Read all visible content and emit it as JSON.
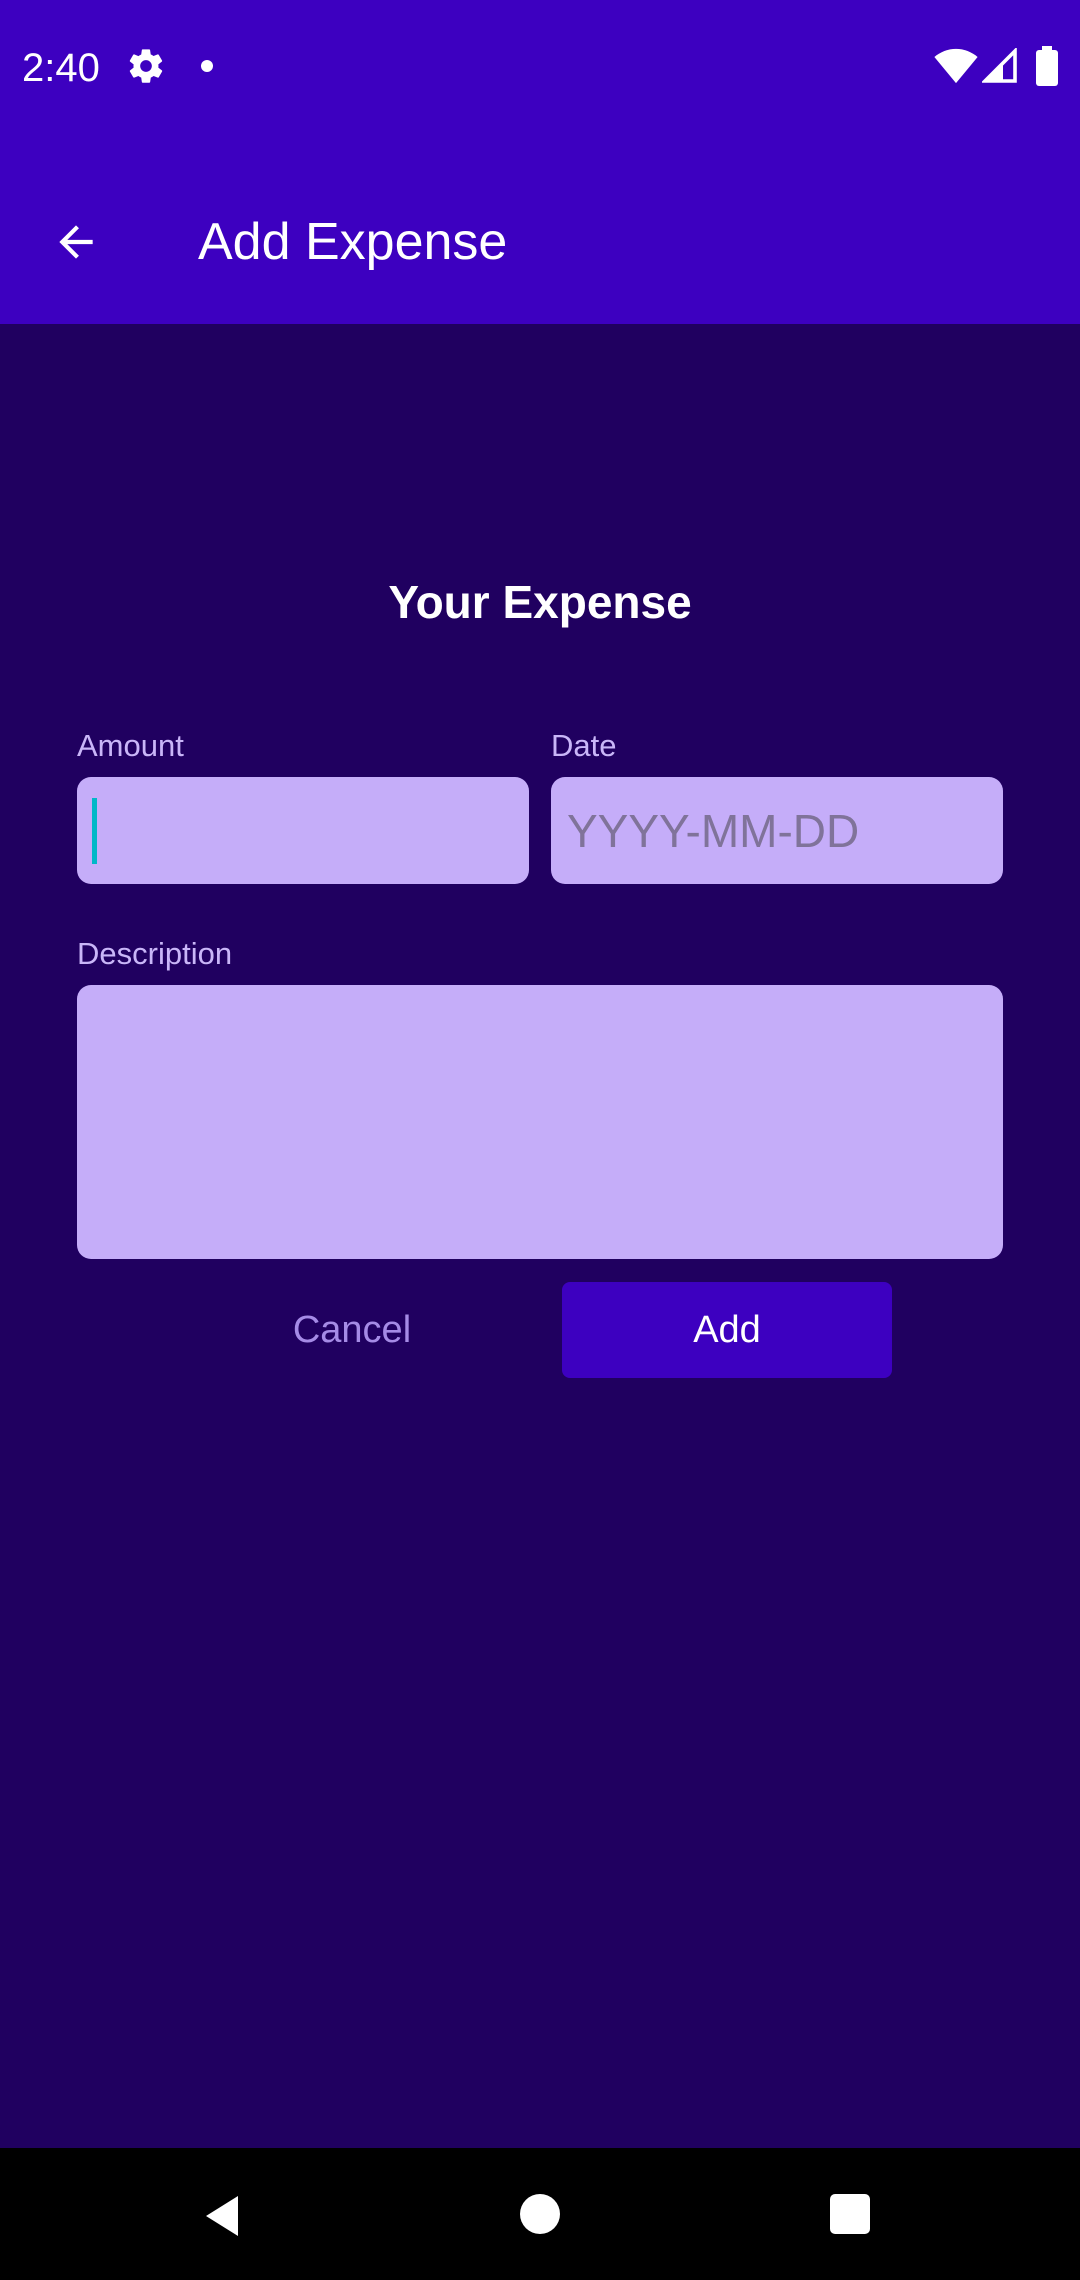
{
  "status_bar": {
    "time": "2:40",
    "icons": [
      "gear-icon",
      "notification-dot-icon",
      "wifi-icon",
      "signal-icon",
      "battery-icon"
    ]
  },
  "app_bar": {
    "title": "Add Expense",
    "back_icon": "arrow-left-icon"
  },
  "form": {
    "heading": "Your Expense",
    "amount": {
      "label": "Amount",
      "value": "",
      "placeholder": ""
    },
    "date": {
      "label": "Date",
      "value": "",
      "placeholder": "YYYY-MM-DD"
    },
    "description": {
      "label": "Description",
      "value": "",
      "placeholder": ""
    },
    "cancel_label": "Cancel",
    "add_label": "Add"
  },
  "nav_bar": {
    "icons": [
      "nav-back-icon",
      "nav-home-icon",
      "nav-recents-icon"
    ]
  },
  "colors": {
    "app_bar": "#3D00C0",
    "background": "#200060",
    "field": "#C5ADF9",
    "label": "#C9B6F8",
    "cancel_text": "#A58BE6",
    "caret": "#00B8C8"
  }
}
